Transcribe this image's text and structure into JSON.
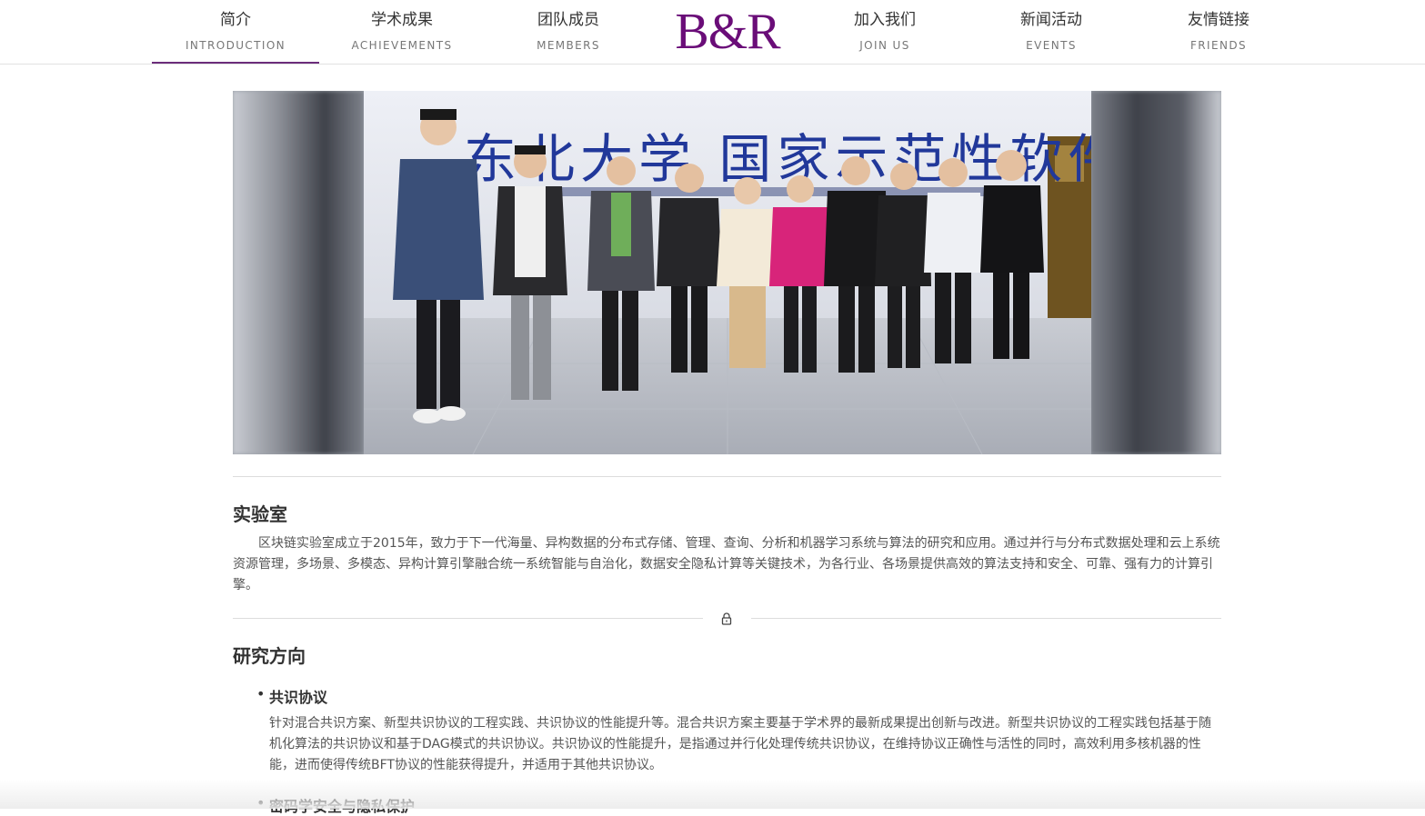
{
  "nav": {
    "items": [
      {
        "zh": "简介",
        "en": "INTRODUCTION",
        "active": true
      },
      {
        "zh": "学术成果",
        "en": "ACHIEVEMENTS"
      },
      {
        "zh": "团队成员",
        "en": "MEMBERS"
      },
      {
        "zh": "加入我们",
        "en": "JOIN US"
      },
      {
        "zh": "新闻活动",
        "en": "EVENTS"
      },
      {
        "zh": "友情链接",
        "en": "FRIENDS"
      }
    ],
    "logo": "B&R"
  },
  "hero": {
    "banner_text": "东北大学 国家示范性软件学院"
  },
  "lab": {
    "title": "实验室",
    "description": "区块链实验室成立于2015年，致力于下一代海量、异构数据的分布式存储、管理、查询、分析和机器学习系统与算法的研究和应用。通过并行与分布式数据处理和云上系统资源管理，多场景、多模态、异构计算引擎融合统一系统智能与自治化，数据安全隐私计算等关键技术，为各行业、各场景提供高效的算法支持和安全、可靠、强有力的计算引擎。"
  },
  "research": {
    "title": "研究方向",
    "items": [
      {
        "title": "共识协议",
        "body": "针对混合共识方案、新型共识协议的工程实践、共识协议的性能提升等。混合共识方案主要基于学术界的最新成果提出创新与改进。新型共识协议的工程实践包括基于随机化算法的共识协议和基于DAG模式的共识协议。共识协议的性能提升，是指通过并行化处理传统共识协议，在维持协议正确性与活性的同时，高效利用多核机器的性能，进而使得传统BFT协议的性能获得提升，并适用于其他共识协议。"
      },
      {
        "title": "密码学安全与隐私保护"
      }
    ]
  },
  "colors": {
    "brand": "#6a0d78",
    "active_underline": "#6b2d7b",
    "divider": "#dcdcdc"
  },
  "icons": {
    "divider_icon": "lock-icon"
  }
}
